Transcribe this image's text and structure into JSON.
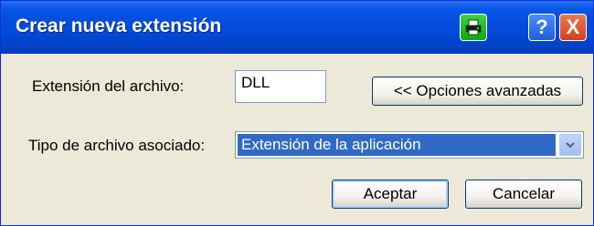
{
  "window": {
    "title": "Crear nueva extensión",
    "buttons": {
      "print_icon": "printer-icon",
      "help_label": "?",
      "close_label": "X"
    }
  },
  "form": {
    "extension_label": "Extensión del archivo:",
    "extension_value": "DLL",
    "advanced_button": "<< Opciones avanzadas",
    "type_label": "Tipo de archivo asociado:",
    "type_selected": "Extensión de la aplicación",
    "ok_button": "Aceptar",
    "cancel_button": "Cancelar"
  },
  "colors": {
    "titlebar": "#0249d6",
    "selection": "#316ac5",
    "face": "#ece9d8"
  }
}
